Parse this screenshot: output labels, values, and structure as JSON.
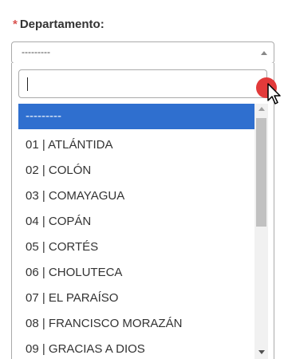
{
  "field": {
    "required_mark": "*",
    "label": "Departamento:",
    "selected_value": "---------"
  },
  "search": {
    "value": "",
    "placeholder": ""
  },
  "options": [
    {
      "label": "---------",
      "selected": true
    },
    {
      "label": "01 | ATLÁNTIDA",
      "selected": false
    },
    {
      "label": "02 | COLÓN",
      "selected": false
    },
    {
      "label": "03 | COMAYAGUA",
      "selected": false
    },
    {
      "label": "04 | COPÁN",
      "selected": false
    },
    {
      "label": "05 | CORTÉS",
      "selected": false
    },
    {
      "label": "06 | CHOLUTECA",
      "selected": false
    },
    {
      "label": "07 | EL PARAÍSO",
      "selected": false
    },
    {
      "label": "08 | FRANCISCO MORAZÁN",
      "selected": false
    },
    {
      "label": "09 | GRACIAS A DIOS",
      "selected": false
    }
  ],
  "colors": {
    "highlight": "#2f6fcf",
    "required": "#d9534f",
    "cursor_dot": "#e23a3a"
  },
  "icons": {
    "select_arrow": "chevron-up-icon",
    "cursor": "mouse-pointer-icon"
  }
}
